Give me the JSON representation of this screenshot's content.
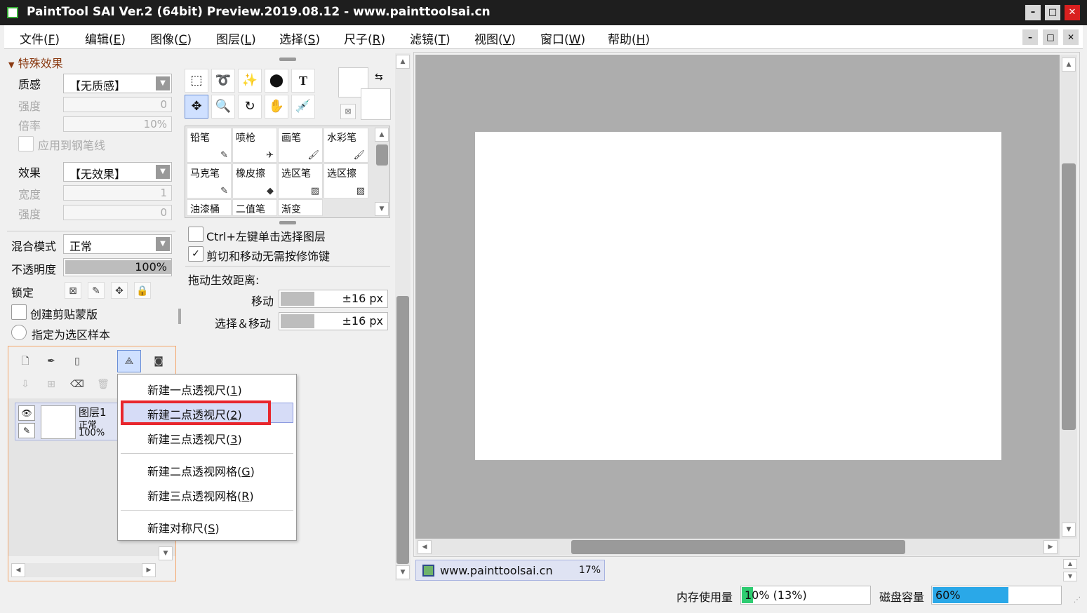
{
  "title": "PaintTool SAI Ver.2 (64bit) Preview.2019.08.12 - www.painttoolsai.cn",
  "window_controls": {
    "minimize": "–",
    "maximize": "□",
    "close": "✕"
  },
  "menu": [
    {
      "label": "文件(",
      "key": "F",
      "end": ")"
    },
    {
      "label": "编辑(",
      "key": "E",
      "end": ")"
    },
    {
      "label": "图像(",
      "key": "C",
      "end": ")"
    },
    {
      "label": "图层(",
      "key": "L",
      "end": ")"
    },
    {
      "label": "选择(",
      "key": "S",
      "end": ")"
    },
    {
      "label": "尺子(",
      "key": "R",
      "end": ")"
    },
    {
      "label": "滤镜(",
      "key": "T",
      "end": ")"
    },
    {
      "label": "视图(",
      "key": "V",
      "end": ")"
    },
    {
      "label": "窗口(",
      "key": "W",
      "end": ")"
    },
    {
      "label": "帮助(",
      "key": "H",
      "end": ")"
    }
  ],
  "effects": {
    "header": "特殊效果",
    "texture_label": "质感",
    "texture_value": "【无质感】",
    "intensity_label": "强度",
    "intensity_value": "0",
    "scale_label": "倍率",
    "scale_value": "10%",
    "apply_pen": "应用到钢笔线",
    "effect_label": "效果",
    "effect_value": "【无效果】",
    "width_label": "宽度",
    "width_value": "1",
    "intensity2_label": "强度",
    "intensity2_value": "0"
  },
  "layer_props": {
    "blend_label": "混合模式",
    "blend_value": "正常",
    "opacity_label": "不透明度",
    "opacity_value": "100%",
    "opacity_fraction": 1.0,
    "lock_label": "锁定",
    "clip_label": "创建剪贴蒙版",
    "selection_source_label": "指定为选区样本"
  },
  "layer": {
    "name": "图层1",
    "mode": "正常",
    "opacity": "100%"
  },
  "tools": {
    "text_tool": "T"
  },
  "brushes": [
    {
      "name": "铅笔"
    },
    {
      "name": "喷枪"
    },
    {
      "name": "画笔"
    },
    {
      "name": "水彩笔"
    },
    {
      "name": "马克笔"
    },
    {
      "name": "橡皮擦"
    },
    {
      "name": "选区笔"
    },
    {
      "name": "选区擦"
    },
    {
      "name": "油漆桶"
    },
    {
      "name": "二值笔"
    },
    {
      "name": "渐变"
    }
  ],
  "options": {
    "ctrl_select": "Ctrl+左键单击选择图层",
    "cut_move": "剪切和移动无需按修饰键",
    "cut_move_checked": "✓",
    "drag_header": "拖动生效距离:",
    "move_label": "移动",
    "move_value": "±16 px",
    "selmove_label": "选择＆移动",
    "selmove_value": "±16 px"
  },
  "popup": [
    {
      "label": "新建一点透视尺(",
      "key": "1",
      "end": ")"
    },
    {
      "label": "新建二点透视尺(",
      "key": "2",
      "end": ")"
    },
    {
      "label": "新建三点透视尺(",
      "key": "3",
      "end": ")"
    },
    {
      "label": "新建二点透视网格(",
      "key": "G",
      "end": ")"
    },
    {
      "label": "新建三点透视网格(",
      "key": "R",
      "end": ")"
    },
    {
      "label": "新建对称尺(",
      "key": "S",
      "end": ")"
    }
  ],
  "document_tab": {
    "name": "www.painttoolsai.cn",
    "zoom": "17%"
  },
  "status": {
    "memory_label": "内存使用量",
    "memory_value": "10% (13%)",
    "memory_fraction": 0.1,
    "disk_label": "磁盘容量",
    "disk_value": "60%",
    "disk_fraction": 0.6
  },
  "colors": {
    "highlight": "#e8262d",
    "accent_bar": "#2aa8e8",
    "memory_bar": "#2ecc71"
  }
}
